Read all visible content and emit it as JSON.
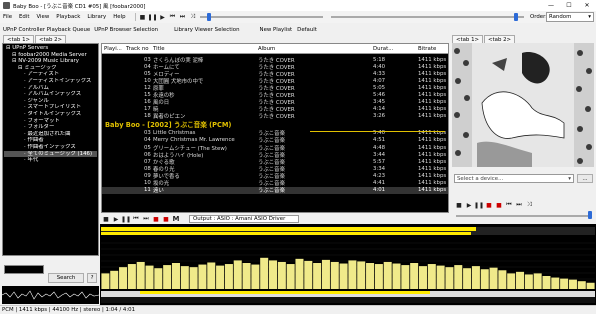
{
  "window": {
    "title": "Baby Boo - [うぶこ音楽 CD1 #05] 風 [foobar2000]",
    "minimize": "—",
    "maximize": "☐",
    "close": "✕"
  },
  "menu": [
    "File",
    "Edit",
    "View",
    "Playback",
    "Library",
    "Help"
  ],
  "toolbar": {
    "order_label": "Order:",
    "order_value": "Random",
    "stop": "■",
    "pause": "❚❚",
    "play": "▶",
    "prev": "⏮",
    "next": "⏭",
    "rand": "⤨",
    "volume_level": 0.97,
    "seek_position": 0.06
  },
  "upnp_tabs": [
    "UPnP Controller Playback Queue",
    "UPnP Browser Selection",
    "Library Viewer Selection",
    "New Playlist",
    "Default"
  ],
  "left_tabs": [
    "<tab 1>",
    "<tab 2>"
  ],
  "right_tabs": [
    "<tab 1>",
    "<tab 2>"
  ],
  "tree": [
    {
      "label": "UPnP Servers",
      "indent": 0
    },
    {
      "label": "foobar2000 Media Server",
      "indent": 1
    },
    {
      "label": "NV-2009 Music Library",
      "indent": 1
    },
    {
      "label": "ミュージック",
      "indent": 2
    },
    {
      "label": "アーティスト",
      "indent": 3
    },
    {
      "label": "アーティストインデックス",
      "indent": 3
    },
    {
      "label": "アルバム",
      "indent": 3
    },
    {
      "label": "アルバムインデックス",
      "indent": 3
    },
    {
      "label": "ジャンル",
      "indent": 3
    },
    {
      "label": "スマートプレイリスト",
      "indent": 3
    },
    {
      "label": "タイトルインデックス",
      "indent": 3
    },
    {
      "label": "フォーマット",
      "indent": 3
    },
    {
      "label": "フォルダー",
      "indent": 3
    },
    {
      "label": "最近追加された曲",
      "indent": 3
    },
    {
      "label": "作曲者",
      "indent": 3
    },
    {
      "label": "作曲者インデックス",
      "indent": 3
    },
    {
      "label": "全てのミュージック (146)",
      "indent": 3,
      "selected": true
    },
    {
      "label": "年代",
      "indent": 3
    }
  ],
  "search_button": "Search",
  "help_button": "?",
  "playlist": {
    "headers": [
      "Playi...",
      "Track no",
      "Title",
      "Album",
      "Durat...",
      "Bitrate"
    ],
    "rows_a": [
      {
        "track": "03",
        "title": "さくらんぼの実 泥棒",
        "album": "うたき COVER",
        "dur": "5:18",
        "br": "1411 kbps"
      },
      {
        "track": "04",
        "title": "ホームにて",
        "album": "うたき COVER",
        "dur": "4:40",
        "br": "1411 kbps"
      },
      {
        "track": "05",
        "title": "メロディー",
        "album": "うたき COVER",
        "dur": "4:33",
        "br": "1411 kbps"
      },
      {
        "track": "10",
        "title": "大団圓 犬地市の中で",
        "album": "うたき COVER",
        "dur": "4:07",
        "br": "1411 kbps"
      },
      {
        "track": "12",
        "title": "原罪",
        "album": "うたき COVER",
        "dur": "5:05",
        "br": "1411 kbps"
      },
      {
        "track": "15",
        "title": "永遠の秒",
        "album": "うたき COVER",
        "dur": "5:46",
        "br": "1411 kbps"
      },
      {
        "track": "16",
        "title": "風の日",
        "album": "うたき COVER",
        "dur": "3:45",
        "br": "1411 kbps"
      },
      {
        "track": "17",
        "title": "暁",
        "album": "うたき COVER",
        "dur": "4:14",
        "br": "1411 kbps"
      },
      {
        "track": "18",
        "title": "異者のピエン",
        "album": "うたき COVER",
        "dur": "3:26",
        "br": "1411 kbps"
      }
    ],
    "group": "Baby Boo - [2002] うぶこ音楽 (PCM)",
    "rows_b": [
      {
        "track": "03",
        "title": "Little Christmas",
        "album": "うぶこ音楽",
        "dur": "5:40",
        "br": "1411 kbps"
      },
      {
        "track": "04",
        "title": "Merry Christmas Mr. Lawrence",
        "album": "うぶこ音楽",
        "dur": "4:51",
        "br": "1411 kbps"
      },
      {
        "track": "05",
        "title": "グリームシチュー (The Stew)",
        "album": "うぶこ音楽",
        "dur": "4:48",
        "br": "1411 kbps"
      },
      {
        "track": "06",
        "title": "おはようハイ (Hole)",
        "album": "うぶこ音楽",
        "dur": "3:44",
        "br": "1411 kbps"
      },
      {
        "track": "07",
        "title": "かぐる歌",
        "album": "うぶこ音楽",
        "dur": "5:57",
        "br": "1411 kbps"
      },
      {
        "track": "08",
        "title": "春のり光",
        "album": "うぶこ音楽",
        "dur": "3:34",
        "br": "1411 kbps"
      },
      {
        "track": "09",
        "title": "夢いで香る",
        "album": "うぶこ音楽",
        "dur": "4:23",
        "br": "1411 kbps"
      },
      {
        "track": "10",
        "title": "坂の光",
        "album": "うぶこ音楽",
        "dur": "4:41",
        "br": "1411 kbps"
      },
      {
        "track": "11",
        "title": "遠い",
        "album": "うぶこ音楽",
        "dur": "4:01",
        "br": "1411 kbps",
        "current": true
      }
    ]
  },
  "output": {
    "label": "Output :",
    "device": "ASIO : Amani ASIO Driver",
    "m_button": "M"
  },
  "device_select": {
    "placeholder": "Select a device...",
    "more": "..."
  },
  "spectrum": {
    "levels": [
      0.3,
      0.35,
      0.42,
      0.48,
      0.52,
      0.45,
      0.4,
      0.46,
      0.5,
      0.44,
      0.42,
      0.47,
      0.51,
      0.45,
      0.48,
      0.55,
      0.5,
      0.47,
      0.6,
      0.55,
      0.52,
      0.48,
      0.58,
      0.54,
      0.5,
      0.56,
      0.52,
      0.49,
      0.55,
      0.53,
      0.5,
      0.48,
      0.52,
      0.49,
      0.46,
      0.5,
      0.44,
      0.48,
      0.45,
      0.42,
      0.46,
      0.4,
      0.44,
      0.38,
      0.41,
      0.36,
      0.3,
      0.33,
      0.28,
      0.3,
      0.25,
      0.22,
      0.2,
      0.18,
      0.15,
      0.12
    ],
    "color": "#f0ea8a"
  },
  "status": "PCM | 1411 kbps | 44100 Hz | stereo | 1:04 / 4:01",
  "colors": {
    "accent": "#2d6bd7",
    "yellow": "#ffea00",
    "group": "#e0c000"
  }
}
